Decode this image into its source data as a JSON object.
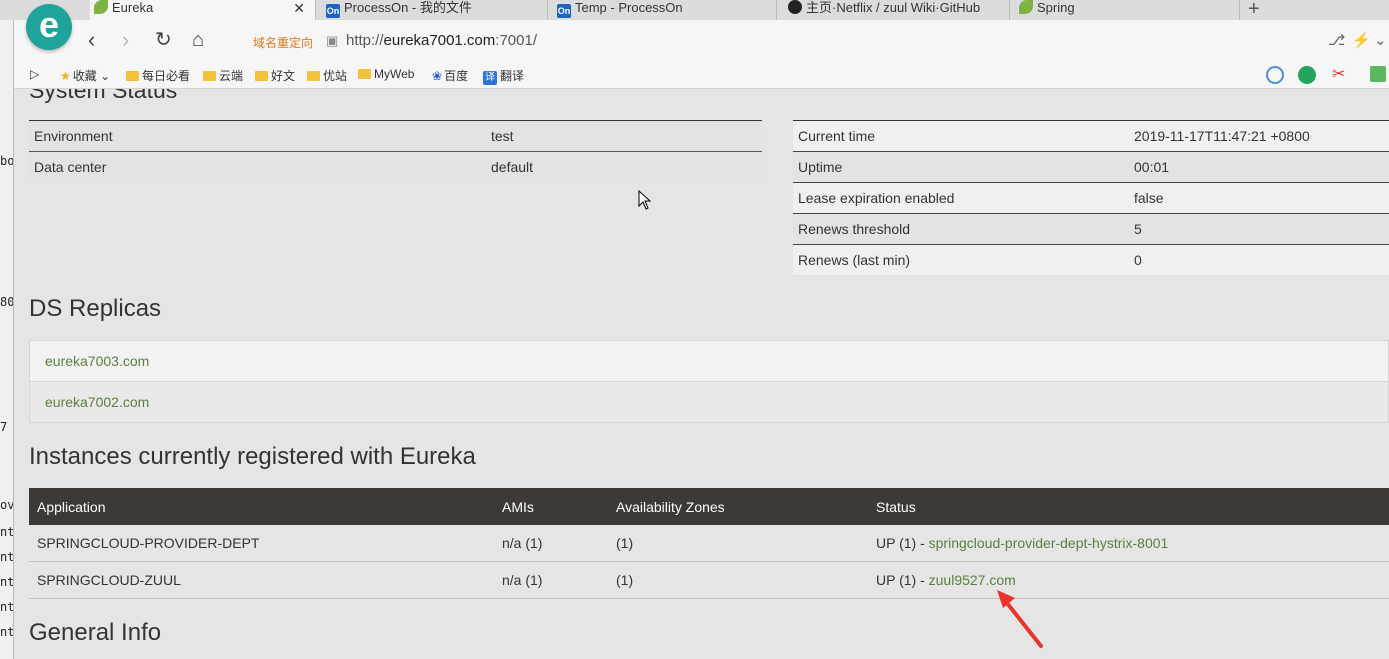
{
  "browser": {
    "tabs": [
      {
        "label": "Eureka",
        "icon": "spring-leaf-icon",
        "active": true
      },
      {
        "label": "ProcessOn - 我的文件",
        "icon": "processon-icon"
      },
      {
        "label": "Temp - ProcessOn",
        "icon": "processon-icon"
      },
      {
        "label": "主页·Netflix / zuul Wiki·GitHub",
        "icon": "github-icon"
      },
      {
        "label": "Spring",
        "icon": "spring-leaf-icon"
      }
    ],
    "tab_icon_text": "On",
    "close_label": "✕",
    "new_tab_label": "+",
    "redirect_label": "域名重定向",
    "url_prefix": "http://",
    "url_host": "eureka7001.com",
    "url_suffix": ":7001/",
    "bookmarks": [
      {
        "label": "收藏",
        "type": "star"
      },
      {
        "label": "每日必看",
        "type": "folder"
      },
      {
        "label": "云端",
        "type": "folder"
      },
      {
        "label": "好文",
        "type": "folder"
      },
      {
        "label": "优站",
        "type": "folder"
      },
      {
        "label": "MyWeb",
        "type": "folder"
      },
      {
        "label": "百度",
        "type": "baidu"
      },
      {
        "label": "翻译",
        "type": "translate"
      }
    ],
    "translate_icon_text": "译"
  },
  "page": {
    "system_status_title": "System Status",
    "system_left": [
      {
        "key": "Environment",
        "value": "test"
      },
      {
        "key": "Data center",
        "value": "default"
      }
    ],
    "system_right": [
      {
        "key": "Current time",
        "value": "2019-11-17T11:47:21 +0800"
      },
      {
        "key": "Uptime",
        "value": "00:01"
      },
      {
        "key": "Lease expiration enabled",
        "value": "false"
      },
      {
        "key": "Renews threshold",
        "value": "5"
      },
      {
        "key": "Renews (last min)",
        "value": "0"
      }
    ],
    "ds_replicas_title": "DS Replicas",
    "ds_replicas": [
      "eureka7003.com",
      "eureka7002.com"
    ],
    "instances_title": "Instances currently registered with Eureka",
    "instances_headers": [
      "Application",
      "AMIs",
      "Availability Zones",
      "Status"
    ],
    "instances": [
      {
        "application": "SPRINGCLOUD-PROVIDER-DEPT",
        "amis": "n/a (1)",
        "zones": "(1)",
        "status": "UP (1) - ",
        "instance": "springcloud-provider-dept-hystrix-8001"
      },
      {
        "application": "SPRINGCLOUD-ZUUL",
        "amis": "n/a (1)",
        "zones": "(1)",
        "status": "UP (1) - ",
        "instance": "zuul9527.com"
      }
    ],
    "general_info_title": "General Info"
  },
  "colors": {
    "link": "#5b7f3e",
    "table_header": "#3d3936",
    "annotation_arrow": "#e8342a"
  }
}
